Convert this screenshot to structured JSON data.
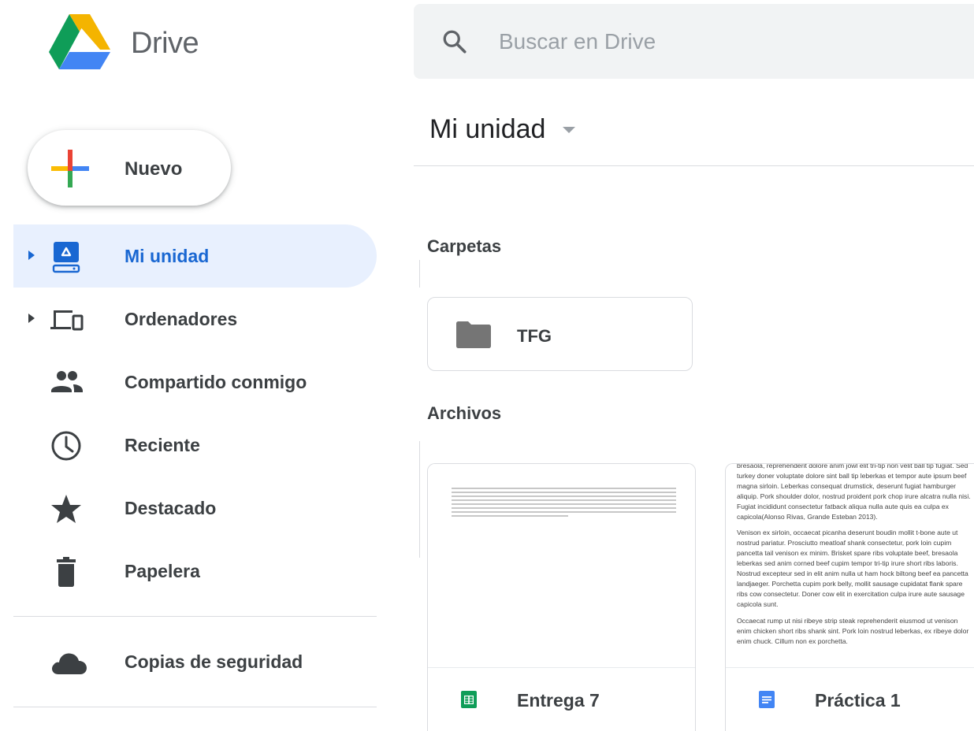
{
  "app": {
    "name": "Drive"
  },
  "search": {
    "placeholder": "Buscar en Drive"
  },
  "new_button": {
    "label": "Nuevo"
  },
  "sidebar": {
    "items": [
      {
        "label": "Mi unidad",
        "icon": "my-drive-icon",
        "active": true,
        "expandable": true
      },
      {
        "label": "Ordenadores",
        "icon": "computers-icon",
        "active": false,
        "expandable": true
      },
      {
        "label": "Compartido conmigo",
        "icon": "shared-icon",
        "active": false,
        "expandable": false
      },
      {
        "label": "Reciente",
        "icon": "clock-icon",
        "active": false,
        "expandable": false
      },
      {
        "label": "Destacado",
        "icon": "star-icon",
        "active": false,
        "expandable": false
      },
      {
        "label": "Papelera",
        "icon": "trash-icon",
        "active": false,
        "expandable": false
      }
    ],
    "backup": {
      "label": "Copias de seguridad",
      "icon": "cloud-icon"
    }
  },
  "main": {
    "title": "Mi unidad",
    "folders_heading": "Carpetas",
    "files_heading": "Archivos",
    "folders": [
      {
        "name": "TFG",
        "icon": "folder-icon"
      }
    ],
    "files": [
      {
        "name": "Entrega 7",
        "type": "spreadsheet",
        "icon": "sheets-icon"
      },
      {
        "name": "Práctica 1",
        "type": "document",
        "icon": "docs-icon",
        "preview_paragraphs": [
          "bresaola, reprehenderit dolore anim jowl elit tri-tip non velit ball tip fugiat. Sed turkey doner voluptate dolore sint ball tip leberkas et tempor aute ipsum beef magna sirloin. Leberkas consequat drumstick, deserunt fugiat hamburger aliquip. Pork shoulder dolor, nostrud proident pork chop irure alcatra nulla nisi. Fugiat incididunt consectetur fatback aliqua nulla aute quis ea culpa ex capicola(Alonso Rivas, Grande Esteban 2013).",
          "Venison ex sirloin, occaecat picanha deserunt boudin mollit t-bone aute ut nostrud pariatur. Prosciutto meatloaf shank consectetur, pork loin cupim pancetta tail venison ex minim. Brisket spare ribs voluptate beef, bresaola leberkas sed anim corned beef cupim tempor tri-tip irure short ribs laboris. Nostrud excepteur sed in elit anim nulla ut ham hock biltong beef ea pancetta landjaeger. Porchetta cupim pork belly, mollit sausage cupidatat flank spare ribs cow consectetur. Doner cow elit in exercitation culpa irure aute sausage capicola sunt.",
          "Occaecat rump ut nisi ribeye strip steak reprehenderit eiusmod ut venison enim chicken short ribs shank sint. Pork loin nostrud leberkas, ex ribeye dolor enim chuck. Cillum non ex porchetta."
        ]
      }
    ]
  },
  "colors": {
    "active_bg": "#e8f0fe",
    "active_text": "#1967d2",
    "drive_green": "#0f9d58",
    "drive_yellow": "#f4b400",
    "drive_blue": "#4285f4",
    "sheets_green": "#0f9d58",
    "docs_blue": "#4285f4"
  }
}
